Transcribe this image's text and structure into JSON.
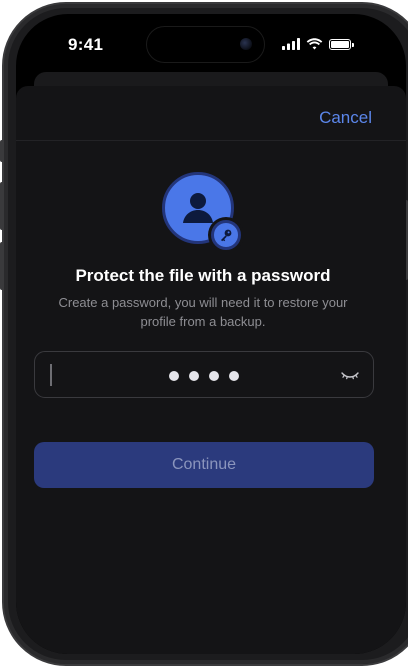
{
  "status_bar": {
    "time": "9:41"
  },
  "sheet": {
    "cancel_label": "Cancel",
    "title": "Protect the file with a password",
    "subtitle": "Create a password, you will need it to restore your profile from a backup.",
    "password": {
      "masked_length": 4,
      "visibility_icon": "eye-closed-icon"
    },
    "continue_label": "Continue"
  },
  "icons": {
    "avatar": "user-icon",
    "badge": "key-icon"
  },
  "colors": {
    "accent": "#5b86ea",
    "avatar_blue": "#4a77e8",
    "button_disabled": "#2b3a7d",
    "background": "#141416"
  }
}
